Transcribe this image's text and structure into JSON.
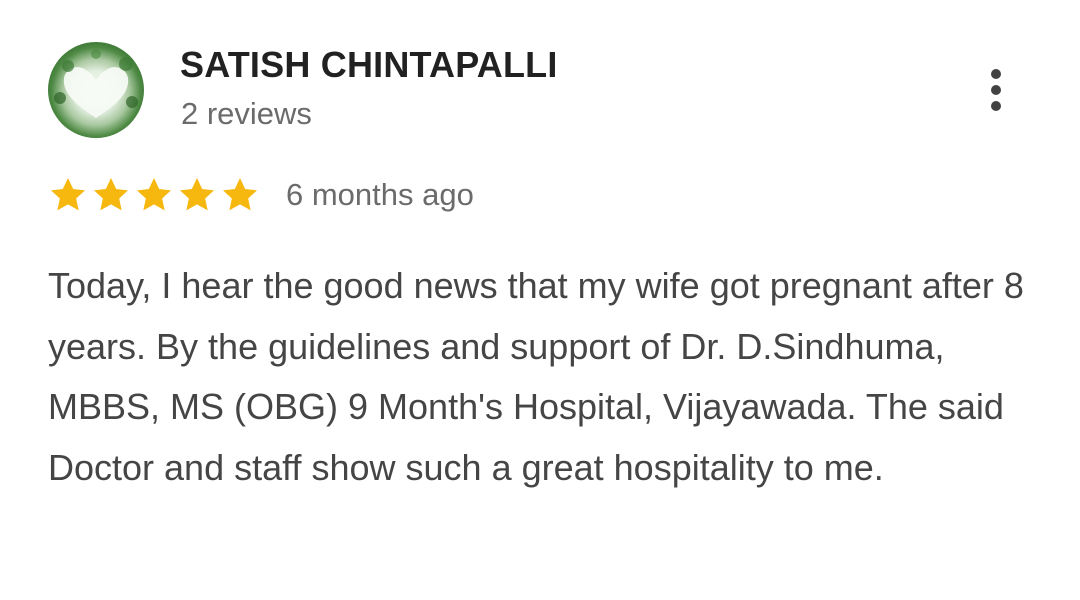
{
  "reviewer": {
    "name": "SATISH CHINTAPALLI",
    "review_count": "2 reviews",
    "avatar_icon": "heart-leaves-avatar"
  },
  "menu": {
    "icon": "more-vertical-icon"
  },
  "rating": {
    "stars": 5,
    "max_stars": 5,
    "star_color": "#F6B80F",
    "time_ago": "6 months ago"
  },
  "review": {
    "text": "Today, I hear the good news that my wife got pregnant after 8 years. By the guidelines and support of Dr. D.Sindhuma, MBBS, MS (OBG) 9 Month's Hospital, Vijayawada. The said Doctor and staff show such a great hospitality to me."
  }
}
